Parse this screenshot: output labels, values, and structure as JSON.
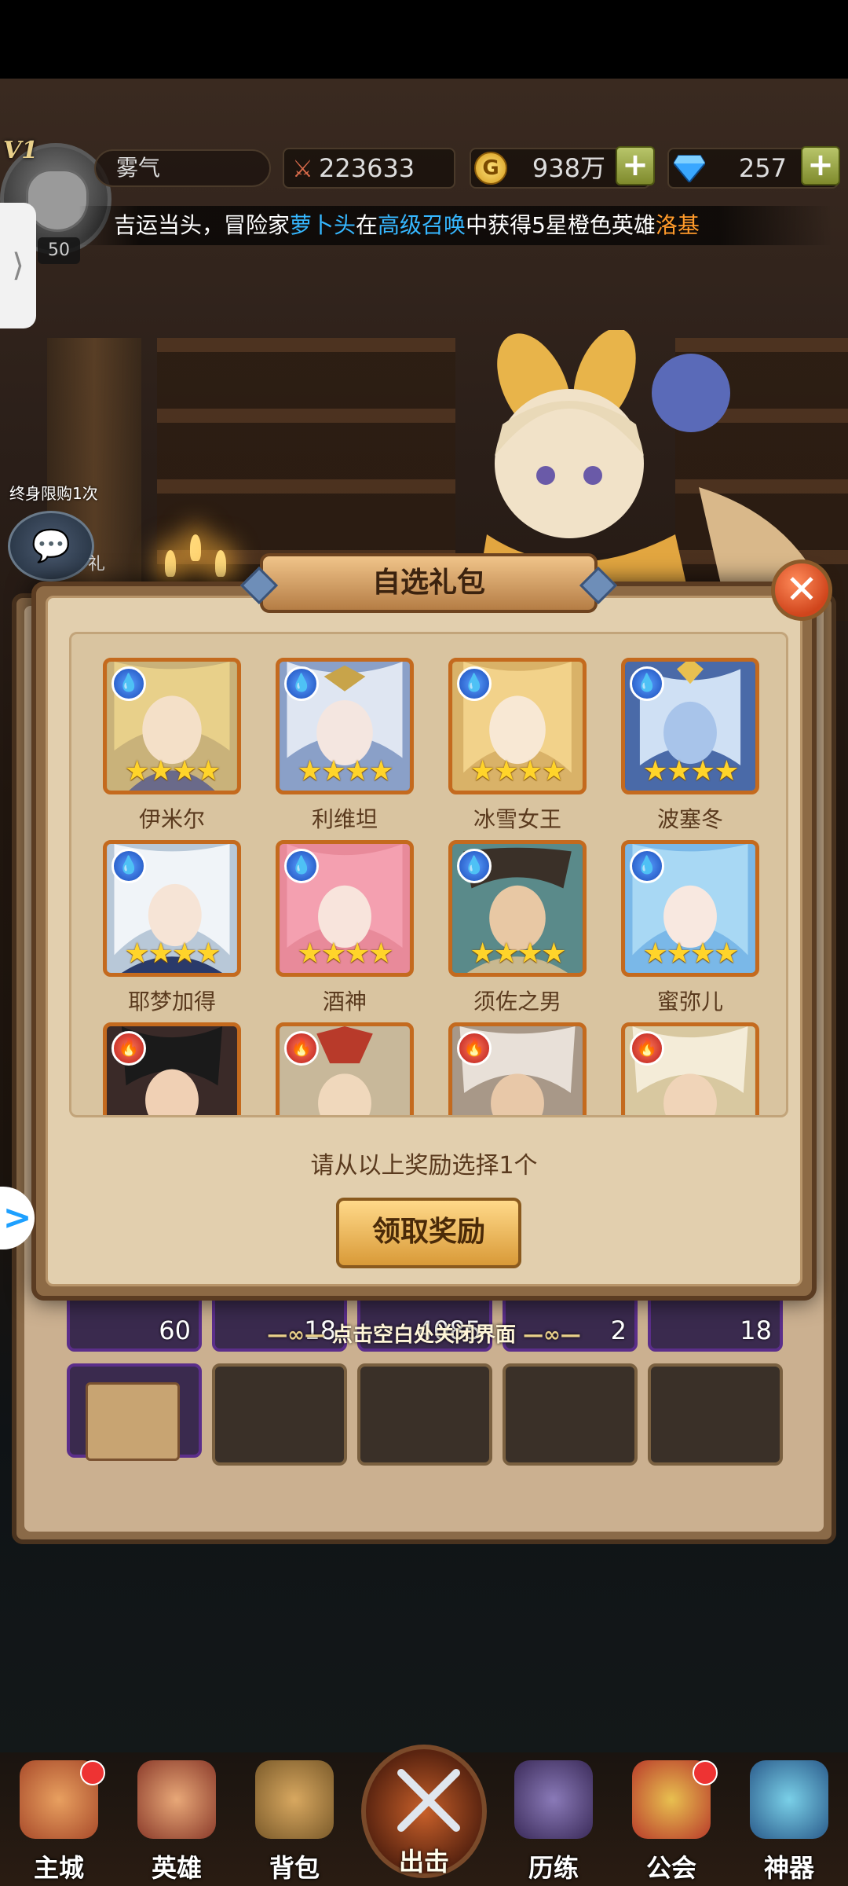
{
  "player": {
    "vip": "V1",
    "level": "50",
    "name": "雾气",
    "power": "223633",
    "gold": "938万",
    "gems": "257"
  },
  "announcement": {
    "prefix": "吉运当头，冒险家",
    "player": "萝卜头",
    "mid1": "在",
    "event": "高级召唤",
    "mid2": "中获得5星橙色英雄",
    "hero": "洛基"
  },
  "side": {
    "limit_label": "终身限购1次",
    "gift_char": "礼"
  },
  "dialog": {
    "title": "自选礼包",
    "prompt": "请从以上奖励选择1个",
    "claim_label": "领取奖励",
    "close_symbol": "✕"
  },
  "heroes": [
    {
      "name": "伊米尔",
      "element": "water",
      "stars": "★★★★"
    },
    {
      "name": "利维坦",
      "element": "water",
      "stars": "★★★★"
    },
    {
      "name": "冰雪女王",
      "element": "water",
      "stars": "★★★★"
    },
    {
      "name": "波塞冬",
      "element": "water",
      "stars": "★★★★"
    },
    {
      "name": "耶梦加得",
      "element": "water",
      "stars": "★★★★"
    },
    {
      "name": "酒神",
      "element": "water",
      "stars": "★★★★"
    },
    {
      "name": "须佐之男",
      "element": "water",
      "stars": "★★★★"
    },
    {
      "name": "蜜弥儿",
      "element": "water",
      "stars": "★★★★"
    },
    {
      "name": "",
      "element": "fire",
      "stars": ""
    },
    {
      "name": "",
      "element": "fire",
      "stars": ""
    },
    {
      "name": "",
      "element": "fire",
      "stars": ""
    },
    {
      "name": "",
      "element": "fire",
      "stars": ""
    }
  ],
  "bag": {
    "counts": [
      "60",
      "18",
      "4085",
      "2",
      "18"
    ],
    "close_hint": "点击空白处关闭界面"
  },
  "nav": {
    "items": [
      "主城",
      "英雄",
      "背包",
      "出击",
      "历练",
      "公会",
      "神器"
    ]
  },
  "colors": {
    "accent_blue": "#36b7ff",
    "accent_orange": "#ff9a2a",
    "card_border": "#c46a1e"
  }
}
